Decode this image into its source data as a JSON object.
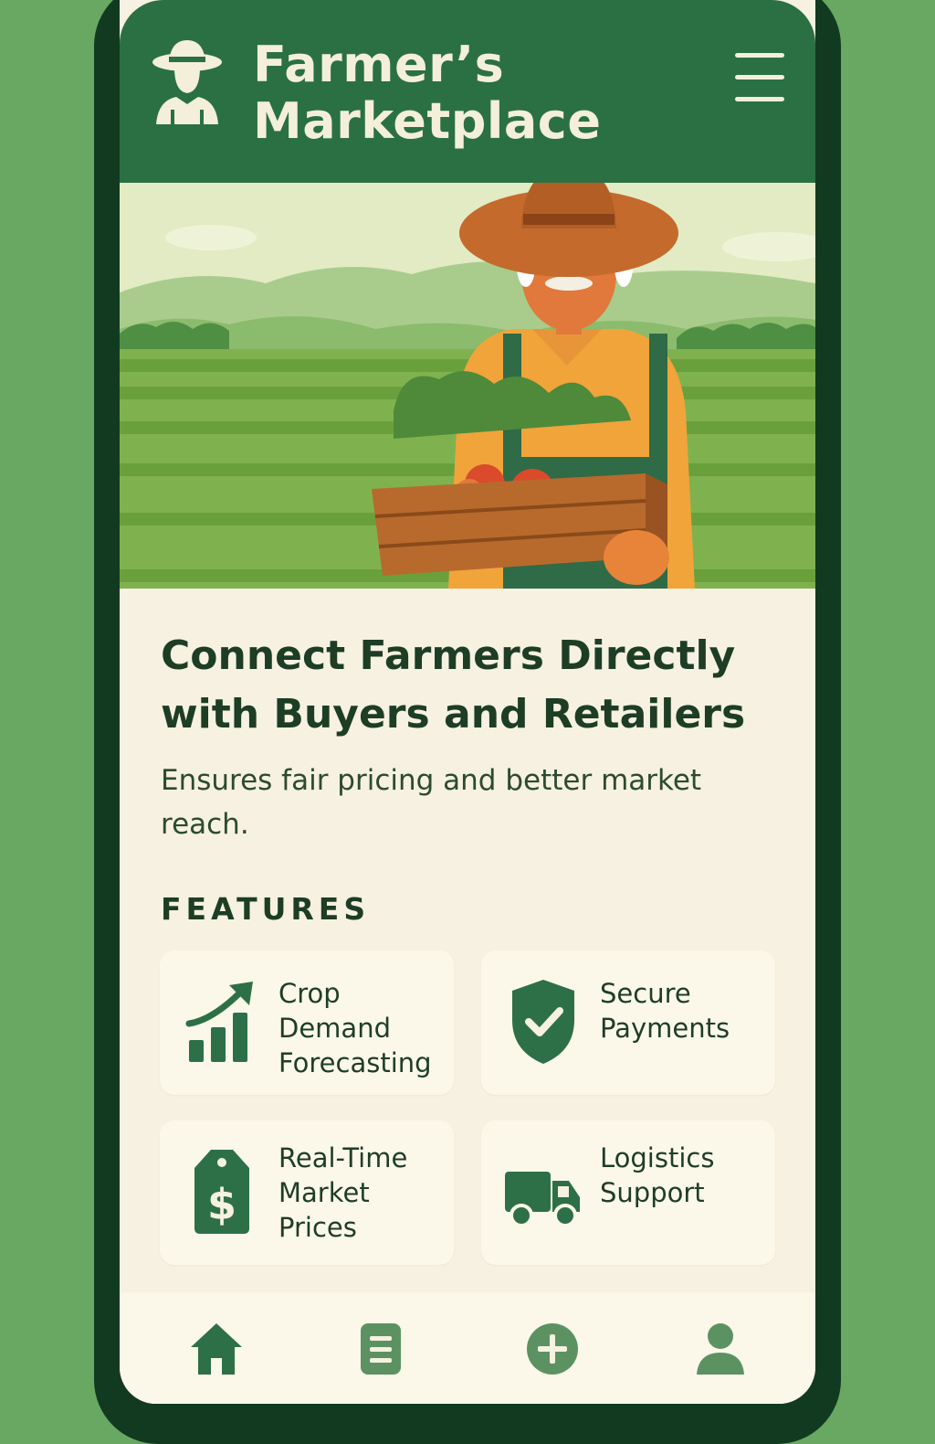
{
  "app": {
    "title": "Farmer’s Marketplace"
  },
  "header": {
    "menu_icon": "hamburger-menu-icon",
    "logo_icon": "farmer-avatar-icon"
  },
  "hero": {
    "headline": "Connect Farmers Directly with Buyers and Retailers",
    "subtext": "Ensures fair pricing and better market reach."
  },
  "features": {
    "label": "FEATURES",
    "items": [
      {
        "label": "Crop Demand Forecasting",
        "icon": "chart-trend-up-icon"
      },
      {
        "label": "Secure Payments",
        "icon": "shield-check-icon"
      },
      {
        "label": "Real-Time Market Prices",
        "icon": "price-tag-dollar-icon"
      },
      {
        "label": "Logistics Support",
        "icon": "delivery-truck-icon"
      }
    ]
  },
  "nav": {
    "items": [
      {
        "icon": "home-icon",
        "active": true
      },
      {
        "icon": "document-list-icon",
        "active": false
      },
      {
        "icon": "plus-circle-icon",
        "active": false
      },
      {
        "icon": "profile-icon",
        "active": false
      }
    ]
  },
  "colors": {
    "header_green": "#2a7043",
    "background_green": "#68a862",
    "bezel": "#123a21",
    "screen_cream": "#f6f1e0",
    "icon_green": "#2d7047",
    "text_dark": "#1d3d25"
  }
}
